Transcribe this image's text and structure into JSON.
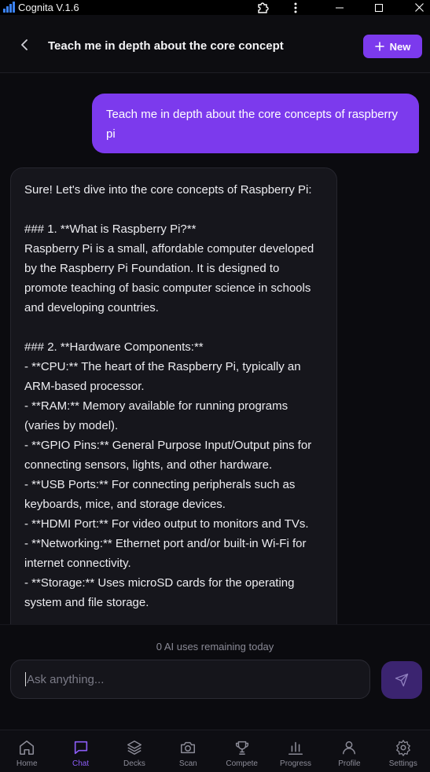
{
  "window": {
    "title": "Cognita V.1.6"
  },
  "header": {
    "title": "Teach me in depth about the core concept",
    "new_label": "New"
  },
  "messages": {
    "user": "Teach me in depth about the core concepts of raspberry pi",
    "assistant": {
      "intro": "Sure! Let's dive into the core concepts of Raspberry Pi:",
      "section1_heading": "### 1. **What is Raspberry Pi?**",
      "section1_body": "Raspberry Pi is a small, affordable computer developed by the Raspberry Pi Foundation. It is designed to promote teaching of basic computer science in schools and developing countries.",
      "section2_heading": "### 2. **Hardware Components:**",
      "items": [
        "- **CPU:** The heart of the Raspberry Pi, typically an ARM-based processor.",
        "- **RAM:** Memory available for running programs (varies by model).",
        "- **GPIO Pins:** General Purpose Input/Output pins for connecting sensors, lights, and other hardware.",
        "- **USB Ports:** For connecting peripherals such as keyboards, mice, and storage devices.",
        "- **HDMI Port:** For video output to monitors and TVs.",
        "- **Networking:** Ethernet port and/or built-in Wi-Fi for internet connectivity.",
        "- **Storage:** Uses microSD cards for the operating system and file storage."
      ]
    }
  },
  "footer": {
    "usage_text": "0 AI uses remaining today",
    "input_placeholder": "Ask anything..."
  },
  "nav": {
    "items": [
      {
        "label": "Home",
        "icon": "home-icon"
      },
      {
        "label": "Chat",
        "icon": "chat-icon",
        "active": true
      },
      {
        "label": "Decks",
        "icon": "layers-icon"
      },
      {
        "label": "Scan",
        "icon": "camera-icon"
      },
      {
        "label": "Compete",
        "icon": "trophy-icon"
      },
      {
        "label": "Progress",
        "icon": "bar-chart-icon"
      },
      {
        "label": "Profile",
        "icon": "user-icon"
      },
      {
        "label": "Settings",
        "icon": "gear-icon"
      }
    ]
  },
  "colors": {
    "accent": "#7c3aed",
    "active_nav": "#8b5cf6",
    "background": "#0b0b0f"
  }
}
